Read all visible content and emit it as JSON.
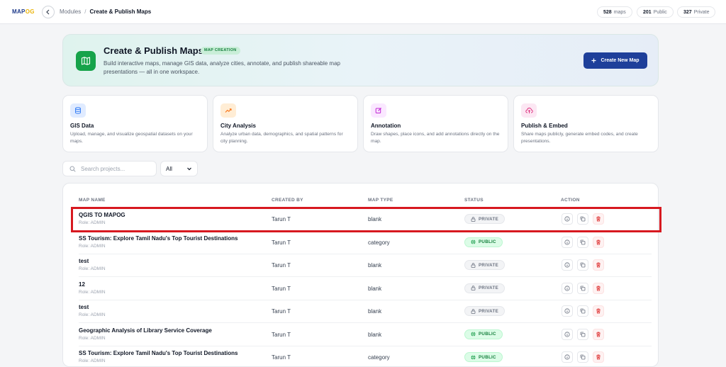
{
  "topbar": {
    "logo_a": "MAP",
    "logo_b": "OG",
    "breadcrumb": {
      "parent": "Modules",
      "separator": "/",
      "current": "Create & Publish Maps"
    },
    "stats": [
      {
        "value": "528",
        "label": "maps"
      },
      {
        "value": "201",
        "label": "Public"
      },
      {
        "value": "327",
        "label": "Private"
      }
    ]
  },
  "hero": {
    "title": "Create & Publish Maps",
    "badge": "MAP CREATION",
    "description": "Build interactive maps, manage GIS data, analyze cities, annotate, and publish shareable map presentations — all in one workspace.",
    "button_label": "Create New Map",
    "button_icon": "plus-icon"
  },
  "features": [
    {
      "title": "GIS Data",
      "description": "Upload, manage, and visualize geospatial datasets on your maps.",
      "icon": "database-icon",
      "color": "#3b82f6"
    },
    {
      "title": "City Analysis",
      "description": "Analyze urban data, demographics, and spatial patterns for city planning.",
      "icon": "trend-icon",
      "color": "#f97316"
    },
    {
      "title": "Annotation",
      "description": "Draw shapes, place icons, and add annotations directly on the map.",
      "icon": "edit-icon",
      "color": "#c026d3"
    },
    {
      "title": "Publish & Embed",
      "description": "Share maps publicly, generate embed codes, and create presentations.",
      "icon": "cloud-upload-icon",
      "color": "#db2777"
    }
  ],
  "search": {
    "placeholder": "Search projects..."
  },
  "filter": {
    "selected": "All"
  },
  "table": {
    "headers": [
      "MAP NAME",
      "CREATED BY",
      "MAP TYPE",
      "STATUS",
      "ACTION"
    ],
    "rows": [
      {
        "name": "QGIS TO MAPOG",
        "role": "Role: ADMIN",
        "created_by": "Tarun T",
        "type": "blank",
        "status": "PRIVATE"
      },
      {
        "name": "SS Tourism: Explore Tamil Nadu's Top Tourist Destinations",
        "role": "Role: ADMIN",
        "created_by": "Tarun T",
        "type": "category",
        "status": "PUBLIC"
      },
      {
        "name": "test",
        "role": "Role: ADMIN",
        "created_by": "Tarun T",
        "type": "blank",
        "status": "PRIVATE"
      },
      {
        "name": "12",
        "role": "Role: ADMIN",
        "created_by": "Tarun T",
        "type": "blank",
        "status": "PRIVATE"
      },
      {
        "name": "test",
        "role": "Role: ADMIN",
        "created_by": "Tarun T",
        "type": "blank",
        "status": "PRIVATE"
      },
      {
        "name": "Geographic Analysis of Library Service Coverage",
        "role": "Role: ADMIN",
        "created_by": "Tarun T",
        "type": "blank",
        "status": "PUBLIC"
      },
      {
        "name": "SS Tourism: Explore Tamil Nadu's Top Tourist Destinations",
        "role": "Role: ADMIN",
        "created_by": "Tarun T",
        "type": "category",
        "status": "PUBLIC"
      }
    ]
  },
  "colors": {
    "accent": "#1e3f9a",
    "brand_green": "#16a34a",
    "highlight": "#d71920"
  }
}
